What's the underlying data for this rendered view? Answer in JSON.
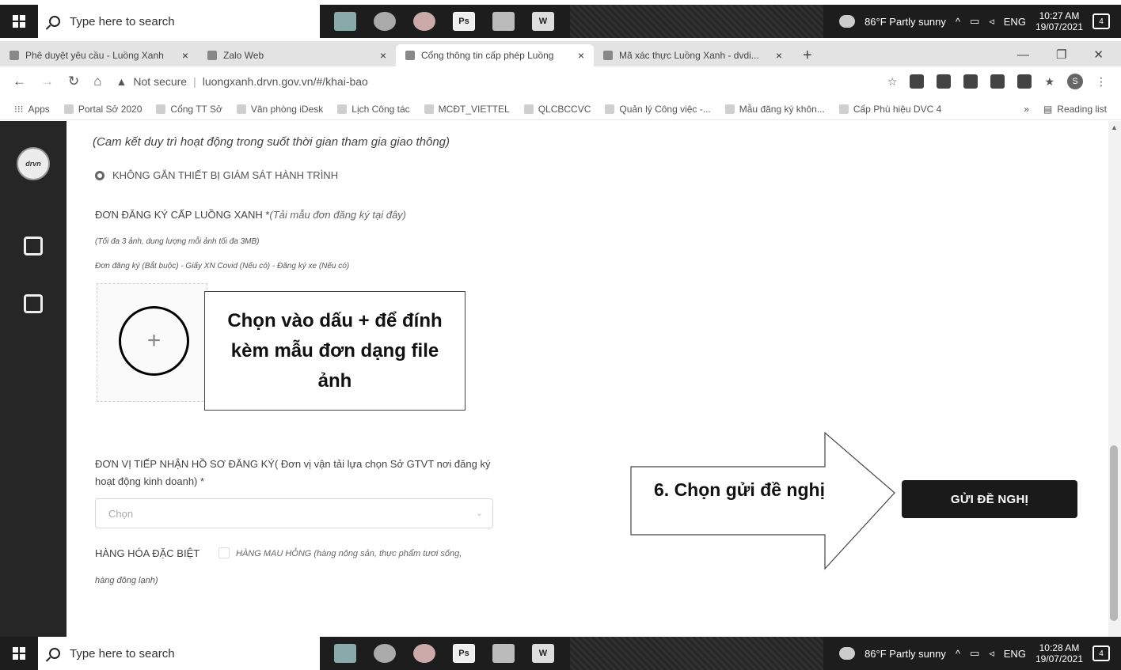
{
  "taskbar_top": {
    "search_placeholder": "Type here to search",
    "apps": [
      "file-explorer",
      "chrome",
      "firefox",
      "Ps",
      "photo",
      "W"
    ],
    "weather": "86°F  Partly sunny",
    "lang": "ENG",
    "time": "10:27 AM",
    "date": "19/07/2021",
    "notif_count": "4"
  },
  "taskbar_bottom": {
    "search_placeholder": "Type here to search",
    "weather": "86°F  Partly sunny",
    "lang": "ENG",
    "time": "10:28 AM",
    "date": "19/07/2021",
    "notif_count": "4"
  },
  "tabs": [
    {
      "label": "Phê duyệt yêu cầu - Luồng Xanh",
      "active": false
    },
    {
      "label": "Zalo Web",
      "active": false
    },
    {
      "label": "Cổng thông tin cấp phép Luồng",
      "active": true
    },
    {
      "label": "Mã xác thực Luồng Xanh - dvdi...",
      "active": false
    }
  ],
  "address": {
    "security": "Not secure",
    "url": "luongxanh.drvn.gov.vn/#/khai-bao",
    "profile_initial": "S"
  },
  "bookmarks": {
    "apps": "Apps",
    "items": [
      "Portal Sở 2020",
      "Cổng TT Sở",
      "Văn phòng iDesk",
      "Lịch Công tác",
      "MCĐT_VIETTEL",
      "QLCBCCVC",
      "Quản lý Công việc -...",
      "Mẫu đăng ký khôn...",
      "Cấp Phù hiệu DVC 4"
    ],
    "more": "»",
    "reading_list": "Reading list"
  },
  "rail": {
    "logo_text": "drvn"
  },
  "form": {
    "commit_note": "(Cam kết duy trì hoạt động trong suốt thời gian tham gia giao thông)",
    "radio_label": "KHÔNG GẮN THIẾT BỊ GIÁM SÁT HÀNH TRÌNH",
    "don_title": "ĐƠN ĐĂNG KÝ CẤP LUỒNG XANH *",
    "don_hint": "(Tải mẫu đơn đăng ký tại đây)",
    "don_note": "(Tối đa 3 ảnh, dung lượng mỗi ảnh tối đa 3MB)",
    "don_types": "Đơn đăng ký (Bắt buộc) - Giấy XN Covid (Nếu có) - Đăng ký xe (Nếu có)",
    "upload_plus": "+",
    "donvi_label": "ĐƠN VỊ TIẾP NHẬN HỒ SƠ ĐĂNG KÝ( Đơn vị vận tải lựa chọn Sở GTVT nơi đăng ký hoạt động kinh doanh) *",
    "select_placeholder": "Chọn",
    "hh_label": "HÀNG HÓA ĐẶC BIỆT",
    "hh_option": "HÀNG MAU HỎNG (hàng nông sản, thực phẩm tươi sống,",
    "hh_option_cont": "hàng đông lạnh)",
    "submit_label": "GỬI ĐỀ NGHỊ"
  },
  "annotations": {
    "callout_upload": "Chọn vào dấu + để đính kèm mẫu đơn dạng file ảnh",
    "callout_submit": "6. Chọn gửi đề nghị"
  }
}
